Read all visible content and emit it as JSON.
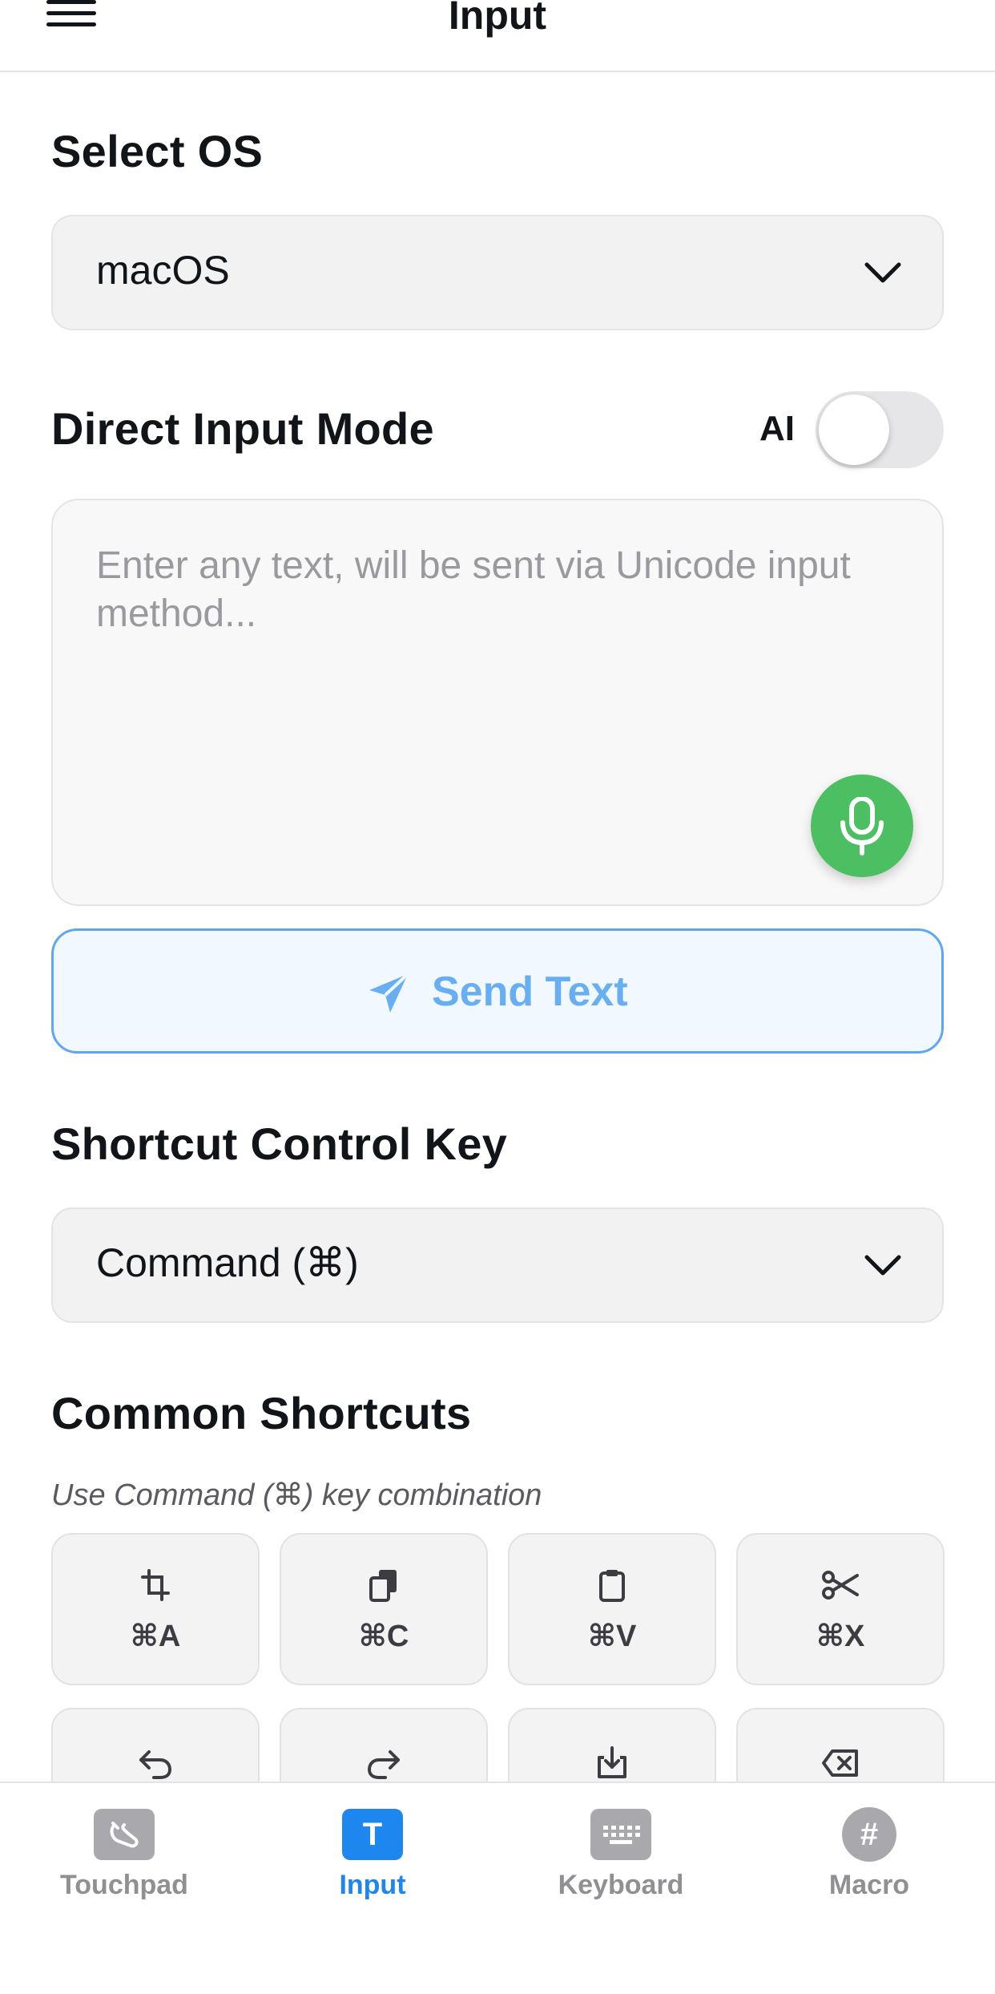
{
  "header": {
    "title": "Input"
  },
  "os_section": {
    "title": "Select OS",
    "selected": "macOS"
  },
  "direct_input": {
    "title": "Direct Input Mode",
    "ai_label": "AI",
    "ai_enabled": false,
    "placeholder": "Enter any text, will be sent via Unicode input method...",
    "send_label": "Send Text"
  },
  "control_key": {
    "title": "Shortcut Control Key",
    "selected": "Command (⌘)"
  },
  "common_shortcuts": {
    "title": "Common Shortcuts",
    "hint": "Use Command (⌘) key combination",
    "items": [
      {
        "label": "⌘A",
        "icon": "crop-icon"
      },
      {
        "label": "⌘C",
        "icon": "copy-icon"
      },
      {
        "label": "⌘V",
        "icon": "clipboard-icon"
      },
      {
        "label": "⌘X",
        "icon": "scissors-icon"
      },
      {
        "label": "",
        "icon": "undo-icon"
      },
      {
        "label": "",
        "icon": "redo-icon"
      },
      {
        "label": "",
        "icon": "save-icon"
      },
      {
        "label": "",
        "icon": "backspace-icon"
      }
    ]
  },
  "tabbar": {
    "active": "Input",
    "tabs": [
      {
        "label": "Touchpad",
        "icon": "touchpad-icon"
      },
      {
        "label": "Input",
        "icon": "text-icon",
        "glyph": "T"
      },
      {
        "label": "Keyboard",
        "icon": "keyboard-icon"
      },
      {
        "label": "Macro",
        "icon": "hash-icon",
        "glyph": "#"
      }
    ]
  },
  "colors": {
    "accent": "#1d86ef",
    "send_text": "#67aef2",
    "mic_green": "#4cbf63",
    "tab_inactive": "#8f8f94"
  }
}
